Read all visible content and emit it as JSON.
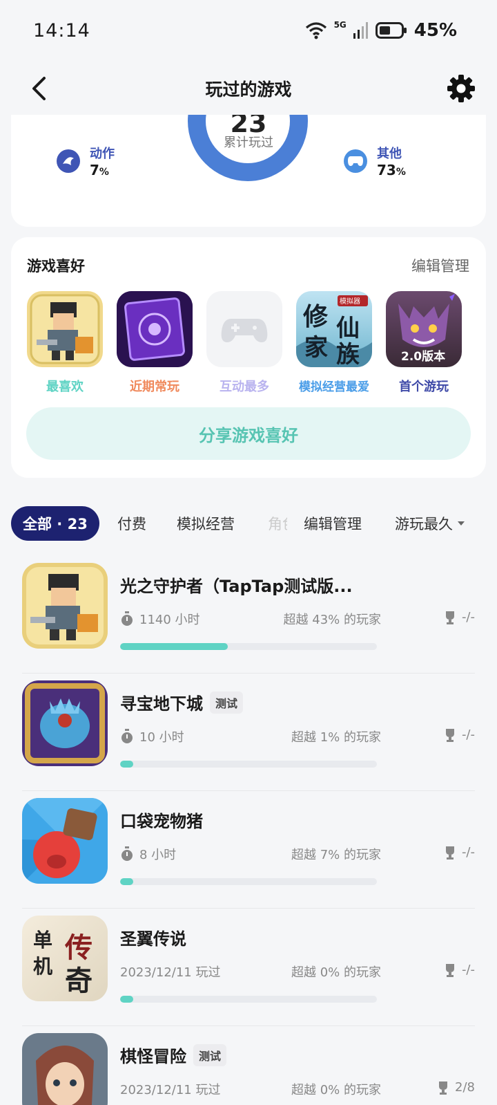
{
  "status_bar": {
    "time": "14:14",
    "network": "5G",
    "battery": "45%"
  },
  "header": {
    "title": "玩过的游戏"
  },
  "stats": {
    "total": "23",
    "total_label": "累计玩过",
    "left": {
      "name": "动作",
      "pct": "7",
      "unit": "%"
    },
    "right": {
      "name": "其他",
      "pct": "73",
      "unit": "%"
    },
    "ring_color": "#4b7fd6"
  },
  "prefs": {
    "title": "游戏喜好",
    "manage": "编辑管理",
    "items": [
      {
        "label": "最喜欢",
        "color": "#5fd3c4"
      },
      {
        "label": "近期常玩",
        "color": "#f08a5d"
      },
      {
        "label": "互动最多",
        "color": "#b9b3ef"
      },
      {
        "label": "模拟经营最爱",
        "color": "#4a9de8"
      },
      {
        "label": "首个游玩",
        "color": "#3f4aa8"
      }
    ],
    "icon_texts": {
      "xiuxian_top": "模拟器",
      "xiuxian_1": "修",
      "xiuxian_2": "仙",
      "xiuxian_3": "家",
      "xiuxian_4": "族",
      "version": "2.0版本"
    },
    "share": "分享游戏喜好"
  },
  "filters": {
    "all": "全部 · 23",
    "tabs": [
      "付费",
      "模拟经营",
      "角色"
    ],
    "manage": "编辑管理",
    "sort": "游玩最久"
  },
  "games": [
    {
      "name": "光之守护者（TapTap测试版...",
      "tag": "",
      "time": "1140 小时",
      "beat": "超越 43% 的玩家",
      "trophy": "-/-",
      "progress": 0.42
    },
    {
      "name": "寻宝地下城",
      "tag": "测试",
      "time": "10 小时",
      "beat": "超越 1% 的玩家",
      "trophy": "-/-",
      "progress": 0.05
    },
    {
      "name": "口袋宠物猪",
      "tag": "",
      "time": "8 小时",
      "beat": "超越 7% 的玩家",
      "trophy": "-/-",
      "progress": 0.05
    },
    {
      "name": "圣翼传说",
      "tag": "",
      "time": "2023/12/11 玩过",
      "beat": "超越 0% 的玩家",
      "trophy": "-/-",
      "progress": 0.05
    },
    {
      "name": "棋怪冒险",
      "tag": "测试",
      "time": "2023/12/11 玩过",
      "beat": "超越 0% 的玩家",
      "trophy": "2/8",
      "progress": 0.05
    }
  ],
  "legend_icon_texts": {
    "shengyi_1": "单",
    "shengyi_2": "机",
    "shengyi_3": "传",
    "shengyi_4": "奇"
  }
}
